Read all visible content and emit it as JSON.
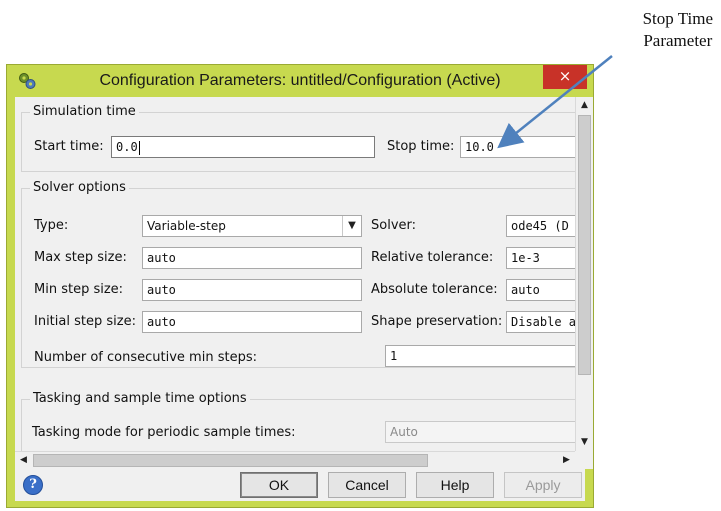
{
  "annotation": {
    "line1": "Stop Time",
    "line2": "Parameter"
  },
  "window": {
    "title": "Configuration Parameters: untitled/Configuration (Active)",
    "close_glyph": "×"
  },
  "simulation_time": {
    "legend": "Simulation time",
    "start_label": "Start time:",
    "start_value": "0.0",
    "stop_label": "Stop time:",
    "stop_value": "10.0"
  },
  "solver_options": {
    "legend": "Solver options",
    "type_label": "Type:",
    "type_value": "Variable-step",
    "solver_label": "Solver:",
    "solver_value": "ode45 (D",
    "max_step_label": "Max step size:",
    "max_step_value": "auto",
    "rel_tol_label": "Relative tolerance:",
    "rel_tol_value": "1e-3",
    "min_step_label": "Min step size:",
    "min_step_value": "auto",
    "abs_tol_label": "Absolute tolerance:",
    "abs_tol_value": "auto",
    "init_step_label": "Initial step size:",
    "init_step_value": "auto",
    "shape_label": "Shape preservation:",
    "shape_value": "Disable a",
    "consec_label": "Number of consecutive min steps:",
    "consec_value": "1"
  },
  "tasking": {
    "legend": "Tasking and sample time options",
    "mode_label": "Tasking mode for periodic sample times:",
    "mode_value": "Auto"
  },
  "scroll_glyphs": {
    "up": "▲",
    "down": "▼",
    "left": "◀",
    "right": "▶",
    "dropdown": "▼"
  },
  "buttons": {
    "ok": "OK",
    "cancel": "Cancel",
    "help": "Help",
    "apply": "Apply"
  },
  "help_icon_glyph": "?",
  "colors": {
    "titlebar": "#c7d94f",
    "close": "#c83228",
    "arrow": "#4f81bd"
  }
}
